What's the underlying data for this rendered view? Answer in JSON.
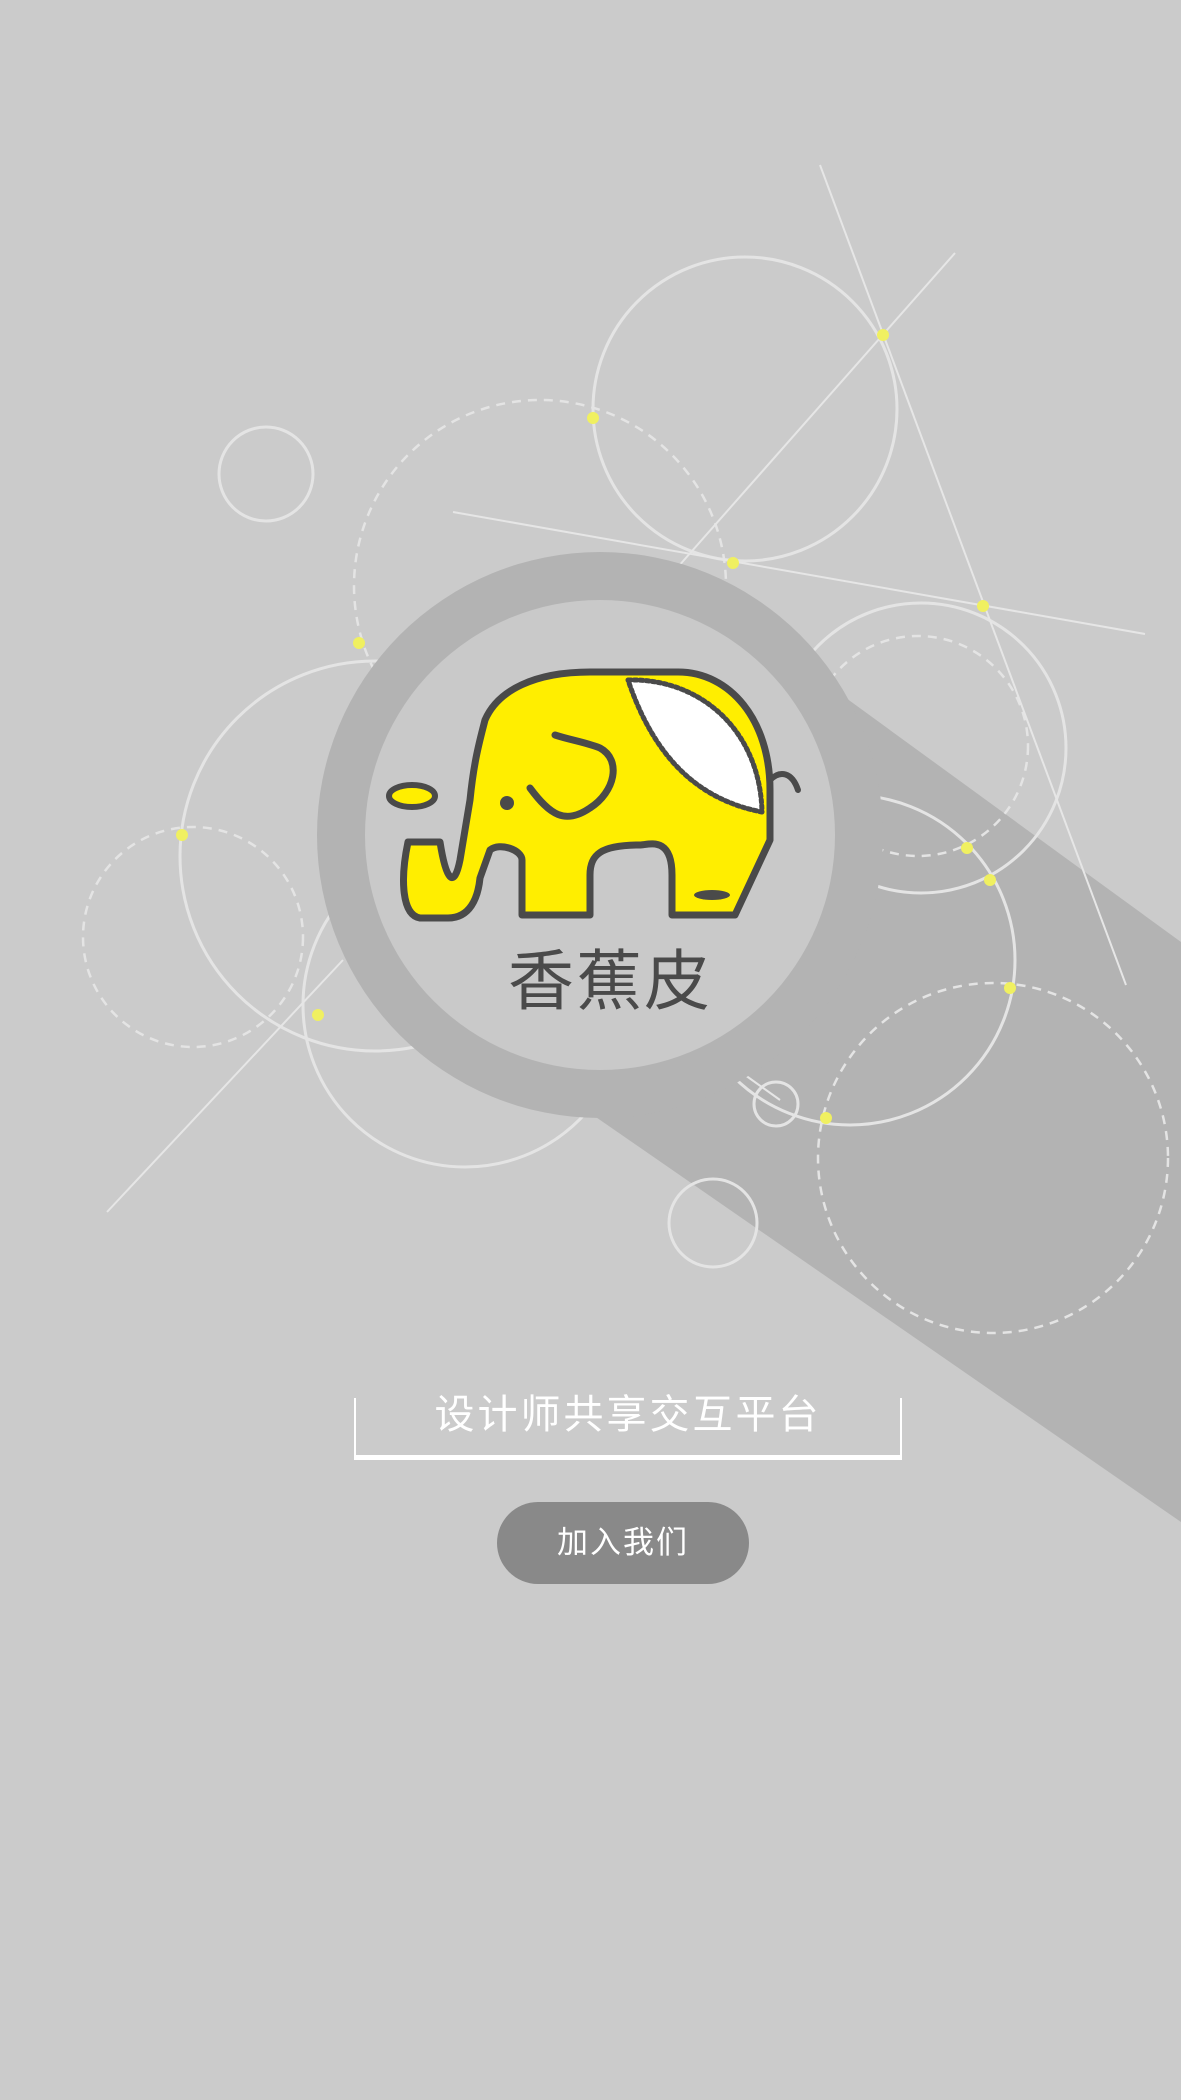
{
  "brand": {
    "name": "香蕉皮",
    "logo_fill": "#ffee00",
    "logo_outline": "#4a4a4a"
  },
  "tagline": "设计师共享交互平台",
  "join_button": {
    "label": "加入我们"
  },
  "colors": {
    "background": "#cbcbcb",
    "magnifier_ring": "#b3b3b3",
    "lens": "#c9c9c9",
    "button": "#898989",
    "accent_dots": "#f0f060"
  }
}
